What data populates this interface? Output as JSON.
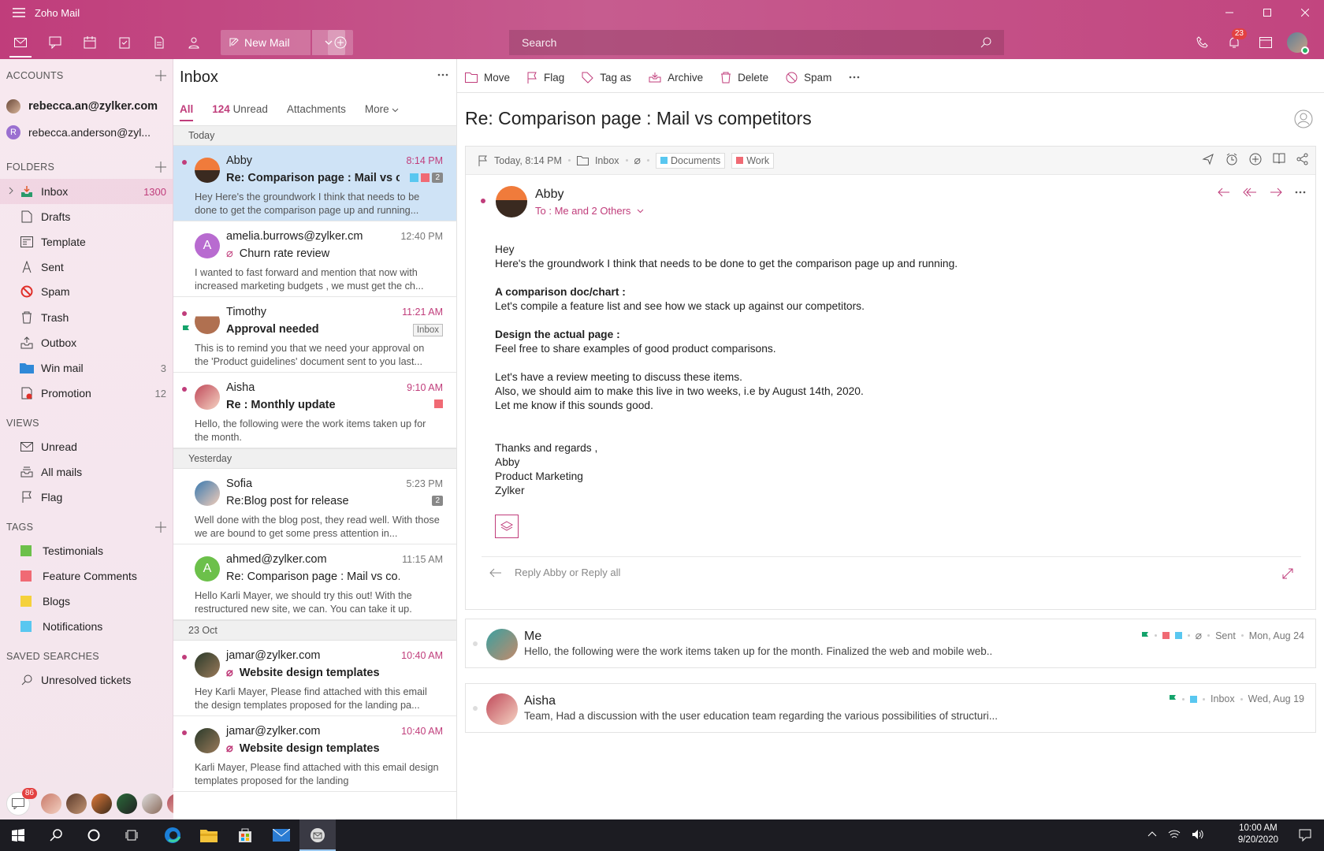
{
  "app": {
    "title": "Zoho Mail"
  },
  "toolbar": {
    "new_mail": "New Mail",
    "search_placeholder": "Search",
    "notification_count": "23"
  },
  "sidebar": {
    "accounts_header": "ACCOUNTS",
    "accounts": [
      "rebecca.an@zylker.com",
      "rebecca.anderson@zyl..."
    ],
    "folders_header": "FOLDERS",
    "folders": [
      {
        "label": "Inbox",
        "count": "1300",
        "icon": "inbox-icon"
      },
      {
        "label": "Drafts",
        "count": "",
        "icon": "drafts-icon"
      },
      {
        "label": "Template",
        "count": "",
        "icon": "template-icon"
      },
      {
        "label": "Sent",
        "count": "",
        "icon": "sent-icon"
      },
      {
        "label": "Spam",
        "count": "",
        "icon": "spam-icon"
      },
      {
        "label": "Trash",
        "count": "",
        "icon": "trash-icon"
      },
      {
        "label": "Outbox",
        "count": "",
        "icon": "outbox-icon"
      },
      {
        "label": "Win mail",
        "count": "3",
        "icon": "folder-icon"
      },
      {
        "label": "Promotion",
        "count": "12",
        "icon": "promotion-icon"
      }
    ],
    "views_header": "VIEWS",
    "views": [
      "Unread",
      "All mails",
      "Flag"
    ],
    "tags_header": "TAGS",
    "tags": [
      {
        "label": "Testimonials",
        "color": "#6cc04a"
      },
      {
        "label": "Feature Comments",
        "color": "#f06a74"
      },
      {
        "label": "Blogs",
        "color": "#f5d13b"
      },
      {
        "label": "Notifications",
        "color": "#59c7f0"
      }
    ],
    "saved_header": "SAVED SEARCHES",
    "saved": [
      "Unresolved tickets"
    ],
    "chat_count": "86"
  },
  "list": {
    "title": "Inbox",
    "tabs": {
      "all": "All",
      "unread_count": "124",
      "unread": "Unread",
      "attachments": "Attachments",
      "more": "More"
    },
    "groups": [
      "Today",
      "Yesterday",
      "23 Oct"
    ],
    "mails": [
      {
        "from": "Abby",
        "time": "8:14 PM",
        "subject": "Re: Comparison page : Mail vs co..",
        "preview": "Hey  Here's the groundwork I think  that needs to be done to get the comparison page up and running...",
        "count": "2"
      },
      {
        "from": "amelia.burrows@zylker.cm",
        "time": "12:40 PM",
        "subject": "Churn rate review",
        "preview": "I wanted to fast forward and mention that now with increased marketing budgets , we must get the ch...",
        "initial": "A"
      },
      {
        "from": "Timothy",
        "time": "11:21 AM",
        "subject": "Approval needed",
        "preview": "This is to remind you that we need your approval on the 'Product guidelines' document sent to you last...",
        "tag": "Inbox"
      },
      {
        "from": "Aisha",
        "time": "9:10 AM",
        "subject": "Re : Monthly update",
        "preview": "Hello, the following were the work items taken up for the month."
      },
      {
        "from": "Sofia",
        "time": "5:23 PM",
        "subject": "Re:Blog post for release",
        "preview": "Well done with the blog post, they read well. With those we are bound to get some press attention in...",
        "count": "2"
      },
      {
        "from": "ahmed@zylker.com",
        "time": "11:15 AM",
        "subject": "Re: Comparison page : Mail vs co...",
        "preview": "Hello Karli Mayer, we should try this out! With the restructured new site, we can. You can take it up.",
        "initial": "A"
      },
      {
        "from": "jamar@zylker.com",
        "time": "10:40 AM",
        "subject": "Website design templates",
        "preview": "Hey Karli Mayer, Please find attached with this email the design templates proposed for the landing pa..."
      },
      {
        "from": "jamar@zylker.com",
        "time": "10:40 AM",
        "subject": "Website design templates",
        "preview": "Karli Mayer, Please find attached with this email design templates proposed for the landing"
      }
    ]
  },
  "reader": {
    "actions": [
      "Move",
      "Flag",
      "Tag as",
      "Archive",
      "Delete",
      "Spam"
    ],
    "subject": "Re: Comparison page : Mail vs competitors",
    "meta": {
      "time": "Today, 8:14 PM",
      "folder": "Inbox",
      "tags": [
        "Documents",
        "Work"
      ]
    },
    "sender": "Abby",
    "to": "To : Me and 2 Others",
    "body_greeting": "Hey",
    "body_line1": "Here's the groundwork I think  that needs to be done to get the comparison page up and running.",
    "body_h1": "A comparison doc/chart :",
    "body_p1": "Let's compile a feature list and see how we stack up against our competitors.",
    "body_h2": "Design the actual page :",
    "body_p2": "Feel free to share examples of good product comparisons.",
    "body_p3a": "Let's have a review meeting to discuss these items.",
    "body_p3b": "Also, we should aim to make this live in two weeks, i.e by August 14th, 2020.",
    "body_p3c": "Let me know if this sounds good.",
    "sign1": "Thanks and regards ,",
    "sign2": "Abby",
    "sign3": "Product Marketing",
    "sign4": "Zylker",
    "reply_placeholder": "Reply Abby or Reply all",
    "conversations": [
      {
        "name": "Me",
        "snippet": "Hello, the following were the work items taken up for the month. Finalized the web and mobile web..",
        "folder": "Sent",
        "date": "Mon, Aug 24"
      },
      {
        "name": "Aisha",
        "snippet": "Team, Had a discussion with the user education team regarding the various possibilities of structuri...",
        "folder": "Inbox",
        "date": "Wed, Aug 19"
      }
    ]
  },
  "taskbar": {
    "time": "10:00 AM",
    "date": "9/20/2020"
  }
}
